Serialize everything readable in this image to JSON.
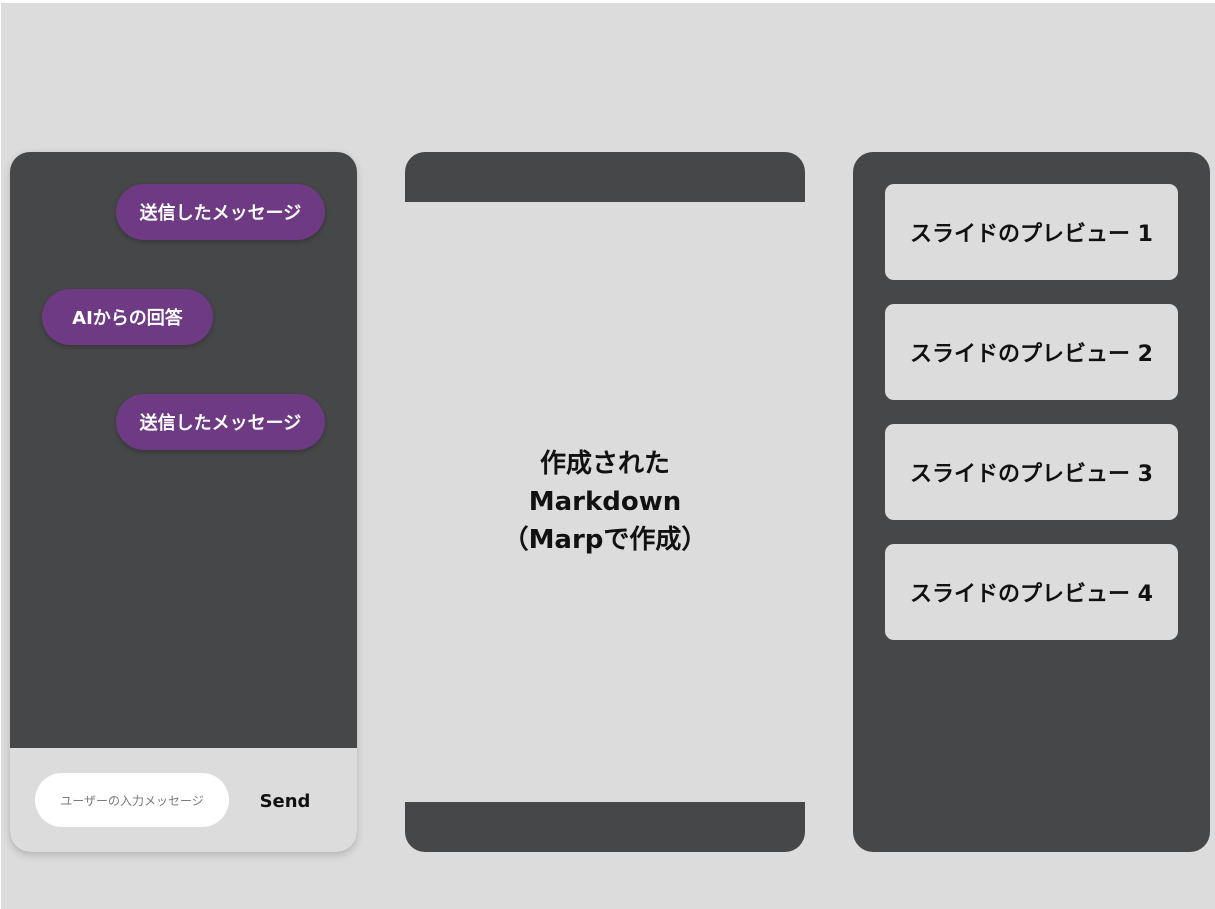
{
  "chat": {
    "messages": [
      {
        "role": "sent",
        "text": "送信したメッセージ"
      },
      {
        "role": "received",
        "text": "AIからの回答"
      },
      {
        "role": "sent",
        "text": "送信したメッセージ"
      }
    ],
    "input_placeholder": "ユーザーの入力メッセージ",
    "send_label": "Send"
  },
  "markdown": {
    "text": "作成された\nMarkdown\n（Marpで作成）"
  },
  "previews": [
    {
      "label": "スライドのプレビュー 1"
    },
    {
      "label": "スライドのプレビュー 2"
    },
    {
      "label": "スライドのプレビュー 3"
    },
    {
      "label": "スライドのプレビュー 4"
    }
  ],
  "colors": {
    "background": "#dcdcdc",
    "panel": "#464749",
    "bubble": "#6e3a83",
    "input": "#ffffff"
  }
}
